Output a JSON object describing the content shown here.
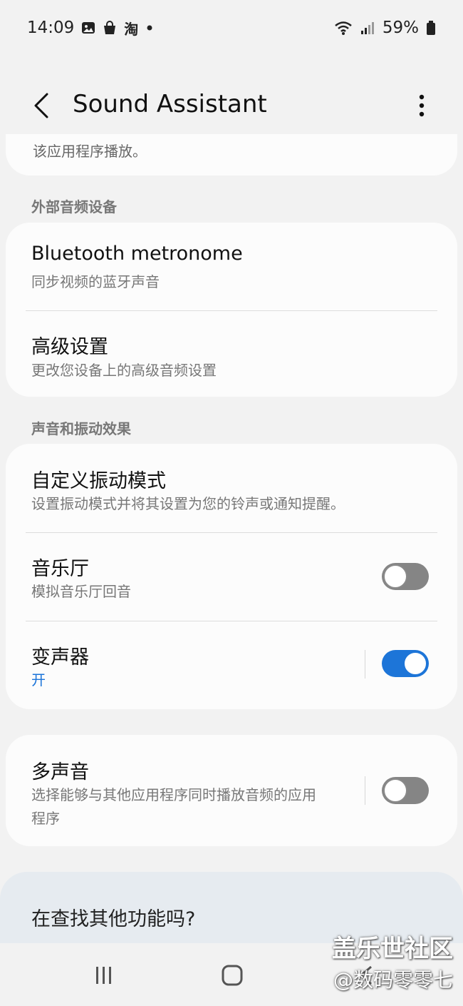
{
  "status_bar": {
    "time": "14:09",
    "left_icons": [
      "image-icon",
      "shopping-bag-icon",
      "taobao-icon",
      "dot-icon"
    ],
    "taobao_glyph": "淘",
    "battery": "59%",
    "right_icons": [
      "wifi-icon",
      "signal-icon",
      "battery-icon"
    ]
  },
  "app_bar": {
    "title": "Sound Assistant",
    "back_icon": "chevron-left-icon",
    "more_icon": "more-vert-icon"
  },
  "top_fragment": {
    "text": "该应用程序播放。"
  },
  "sections": {
    "external_audio": {
      "header": "外部音频设备",
      "items": [
        {
          "title": "Bluetooth metronome",
          "subtitle": "同步视频的蓝牙声音"
        },
        {
          "title": "高级设置",
          "subtitle": "更改您设备上的高级音频设置"
        }
      ]
    },
    "effects": {
      "header": "声音和振动效果",
      "items": [
        {
          "title": "自定义振动模式",
          "subtitle": "设置振动模式并将其设置为您的铃声或通知提醒。"
        },
        {
          "title": "音乐厅",
          "subtitle": "模拟音乐厅回音",
          "toggle": false
        },
        {
          "title": "变声器",
          "subtitle": "开",
          "toggle": true
        }
      ]
    },
    "multi_sound": {
      "title": "多声音",
      "subtitle_line1": "选择能够与其他应用程序同时播放音频的应用",
      "subtitle_line2": "程序",
      "toggle": false
    }
  },
  "looking_for_more": "在查找其他功能吗?",
  "nav_bar": {
    "recents_icon": "recents-icon",
    "home_icon": "home-icon",
    "back_icon": "back-icon"
  },
  "watermark": {
    "line1": "盖乐世社区",
    "line2": "@数码零零七"
  },
  "colors": {
    "accent": "#1d75d8",
    "background": "#f2f2f2",
    "card": "#fcfcfc"
  }
}
